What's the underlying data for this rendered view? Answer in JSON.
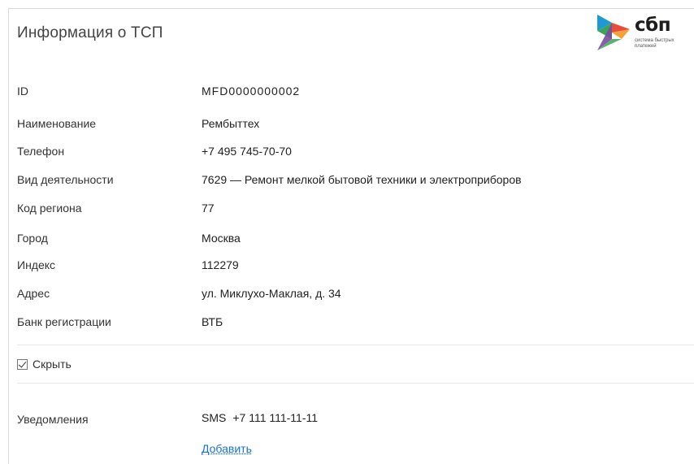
{
  "header": {
    "title": "Информация о ТСП",
    "logo": {
      "name": "сбп",
      "subtitle": "система быстрых платежей",
      "colors": [
        "#1d9ad6",
        "#7a4ba0",
        "#e94b3c",
        "#f3a23a",
        "#3aa655"
      ]
    }
  },
  "fields": [
    {
      "label": "ID",
      "value": "MFD0000000002"
    },
    {
      "label": "Наименование",
      "value": "Рембыттех"
    },
    {
      "label": "Телефон",
      "value": "+7 495 745-70-70"
    },
    {
      "label": "Вид деятельности",
      "value": "7629 — Ремонт мелкой бытовой техники и электроприборов"
    },
    {
      "label": "Код региона",
      "value": "77"
    },
    {
      "label": "Город",
      "value": "Москва"
    },
    {
      "label": "Индекс",
      "value": "112279"
    },
    {
      "label": "Адрес",
      "value": "ул. Миклухо-Маклая, д. 34"
    },
    {
      "label": "Банк регистрации",
      "value": "ВТБ"
    }
  ],
  "hide_checkbox": {
    "label": "Скрыть",
    "checked": true
  },
  "notifications": {
    "label": "Уведомления",
    "channel": "SMS",
    "value": "+7 111 111-11-11",
    "add_label": "Добавить"
  }
}
